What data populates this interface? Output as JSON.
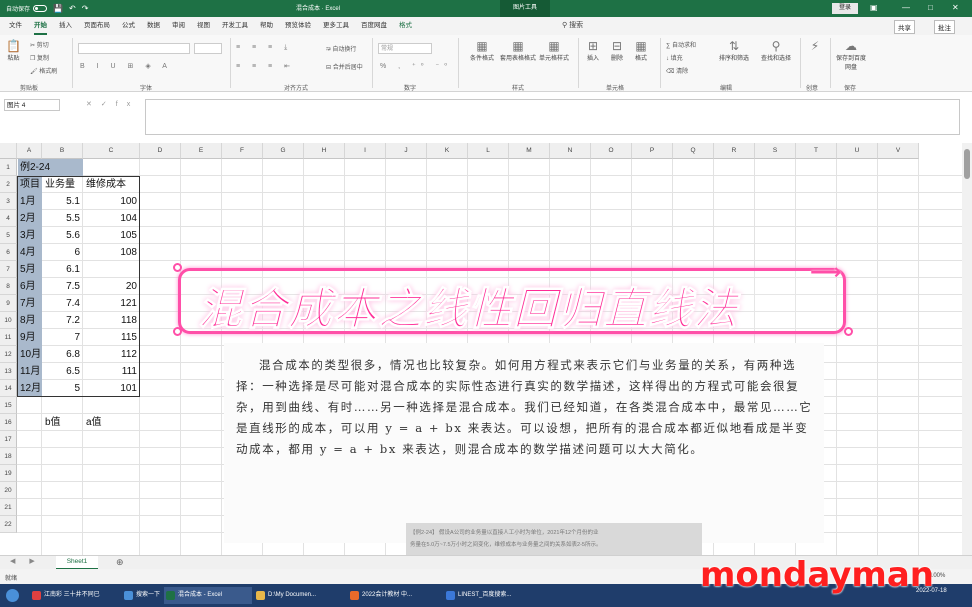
{
  "titlebar": {
    "autosave": "自动保存",
    "autosave_state": "关",
    "title": "混合成本 · Excel",
    "context_tool": "图片工具",
    "login": "登录"
  },
  "menu": [
    "文件",
    "开始",
    "插入",
    "页面布局",
    "公式",
    "数据",
    "审阅",
    "视图",
    "开发工具",
    "帮助",
    "预览体验",
    "更多工具",
    "百度网盘",
    "格式"
  ],
  "menu_active_index": 1,
  "search_label": "搜索",
  "share_label": "共享",
  "comment_label": "批注",
  "ribbon": {
    "clipboard": {
      "label": "剪贴板",
      "paste": "粘贴",
      "cut": "剪切",
      "copy": "复制",
      "format_painter": "格式刷"
    },
    "font": {
      "label": "字体"
    },
    "alignment": {
      "label": "对齐方式",
      "wrap": "自动换行",
      "merge": "合并后居中"
    },
    "number": {
      "label": "数字",
      "format": "常规"
    },
    "styles": {
      "label": "样式",
      "conditional": "条件格式",
      "table": "套用表格格式",
      "cell": "单元格样式"
    },
    "cells": {
      "label": "单元格",
      "insert": "插入",
      "delete": "删除",
      "format": "格式"
    },
    "editing": {
      "label": "编辑",
      "autosum": "自动求和",
      "fill": "填充",
      "clear": "清除",
      "sort": "排序和筛选",
      "find": "查找和选择"
    },
    "ideas": {
      "label": "创意",
      "analyze": "分析数据"
    },
    "save": {
      "label": "保存",
      "baidu": "保存到百度网盘"
    }
  },
  "formula": {
    "namebox": "图片 4",
    "cancel": "✕",
    "enter": "✓",
    "fx": "fx",
    "value": ""
  },
  "columns": [
    "A",
    "B",
    "C",
    "D",
    "E",
    "F",
    "G",
    "H",
    "I",
    "J",
    "K",
    "L",
    "M",
    "N",
    "O",
    "P",
    "Q",
    "R",
    "S",
    "T",
    "U",
    "V"
  ],
  "rows": [
    "1",
    "2",
    "3",
    "4",
    "5",
    "6",
    "7",
    "8",
    "9",
    "10",
    "11",
    "12",
    "13",
    "14",
    "15",
    "16",
    "17",
    "18",
    "19",
    "20",
    "21",
    "22"
  ],
  "sheet": {
    "a1": "例2-24",
    "headers": [
      "项目",
      "业务量",
      "维修成本"
    ],
    "data": [
      [
        "1月",
        "5.1",
        "100"
      ],
      [
        "2月",
        "5.5",
        "104"
      ],
      [
        "3月",
        "5.6",
        "105"
      ],
      [
        "4月",
        "6",
        "108"
      ],
      [
        "5月",
        "6.1",
        ""
      ],
      [
        "6月",
        "7.5",
        "20"
      ],
      [
        "7月",
        "7.4",
        "121"
      ],
      [
        "8月",
        "7.2",
        "118"
      ],
      [
        "9月",
        "7",
        "115"
      ],
      [
        "10月",
        "6.8",
        "112"
      ],
      [
        "11月",
        "6.5",
        "111"
      ],
      [
        "12月",
        "5",
        "101"
      ]
    ],
    "b16": "b值",
    "c16": "a值"
  },
  "picture_text": "混合成本的类型很多，情况也比较复杂。如何用方程式来表示它们与业务量的关系，有两种选择：一种选择是尽可能对混合成本的实际性态进行真实的数学描述，这样得出的方程式可能会很复杂，用到曲线、有时……另一种选择是混合成本。我们已经知道，在各类混合成本中，最常见……它是直线形的成本，可以用 y = a + bx 来表达。可以设想，把所有的混合成本都近似地看成是半变动成本，都用 y = a + bx 来表达，则混合成本的数学描述问题可以大大简化。",
  "banner_text": "混合成本之线性回归直线法",
  "picture2": {
    "line1": "【例2-24】 假设A公司的业务量以直接人工小时为单位，2021年12个月份的业",
    "line2": "务量在5.0万~7.5万小时之间变化，维修成本与业务量之间的关系如表2-5所示。"
  },
  "sheet_tab": "Sheet1",
  "status": {
    "ready": "就绪",
    "zoom": "100%"
  },
  "taskbar": {
    "tasks": [
      {
        "label": "江南彩 三十井不同已",
        "color": "#e04040"
      },
      {
        "label": "搜索一下",
        "color": "#4a90d9"
      },
      {
        "label": "混合成本 - Excel",
        "color": "#1e7145"
      },
      {
        "label": "D:\\My Documen...",
        "color": "#e8b84a"
      },
      {
        "label": "2022会计教材 中...",
        "color": "#e86a2a"
      },
      {
        "label": "LINEST_百度搜索...",
        "color": "#3b78d8"
      }
    ],
    "time": "",
    "date": "2022-07-18"
  },
  "watermark": "mondayman",
  "colors": {
    "excel_green": "#1e7145",
    "banner_pink": "#ff2b96",
    "selection": "#a9b9cc",
    "watermark_red": "#ff1f1f"
  }
}
